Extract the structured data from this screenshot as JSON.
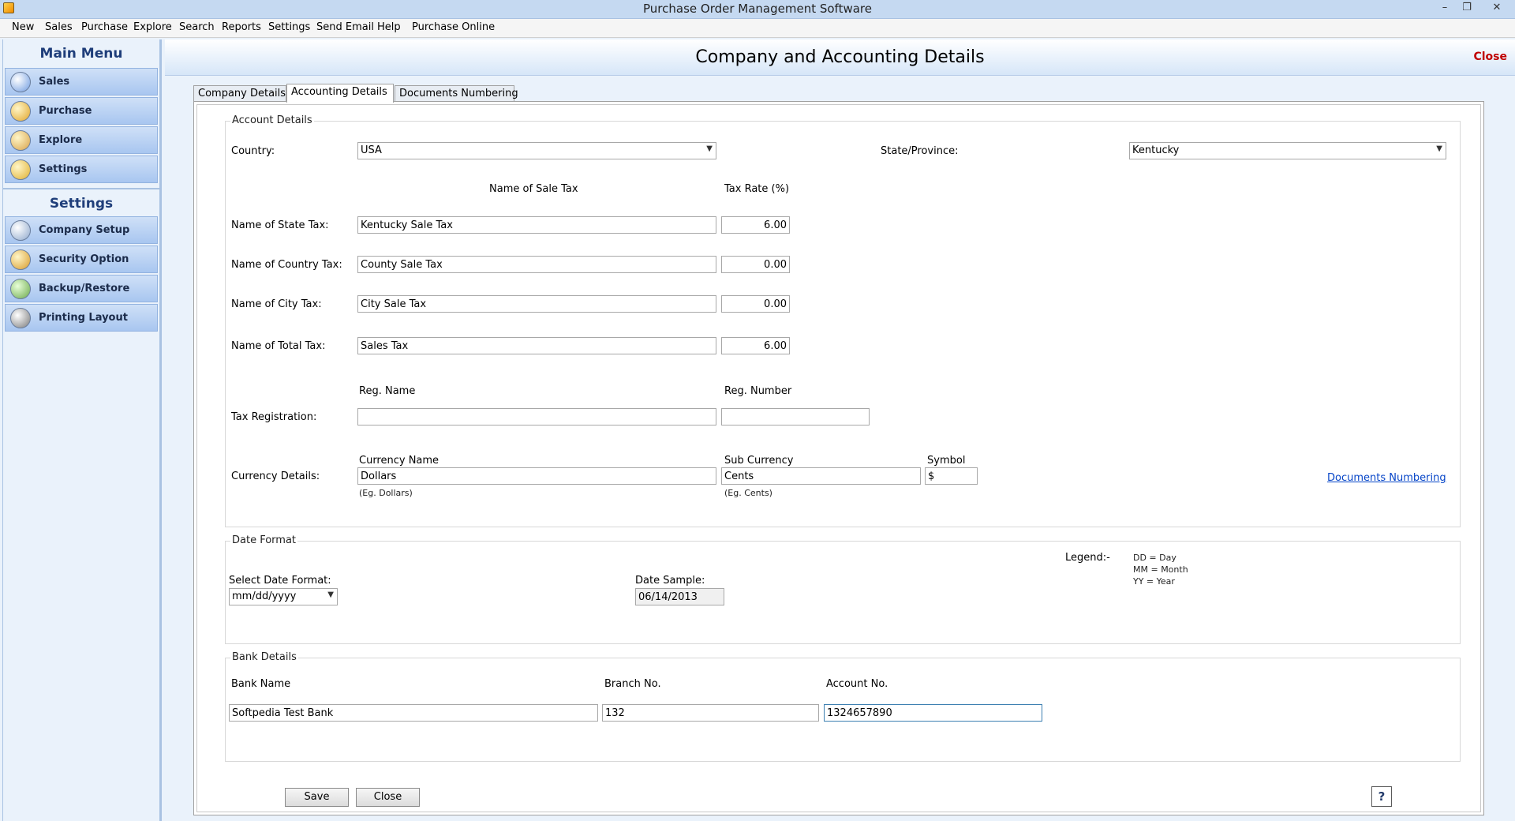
{
  "window": {
    "title": "Purchase Order Management Software",
    "minimize_glyph": "–",
    "restore_glyph": "❐",
    "close_glyph": "✕"
  },
  "menu": [
    "New",
    "Sales",
    "Purchase",
    "Explore",
    "Search",
    "Reports",
    "Settings",
    "Send Email",
    "Help",
    "Purchase Online"
  ],
  "sidebar": {
    "main_menu_title": "Main Menu",
    "main_items": [
      {
        "label": "Sales",
        "icon": "sales-chart-icon"
      },
      {
        "label": "Purchase",
        "icon": "purchase-box-icon"
      },
      {
        "label": "Explore",
        "icon": "explore-icon"
      },
      {
        "label": "Settings",
        "icon": "settings-gear-icon"
      }
    ],
    "settings_title": "Settings",
    "settings_items": [
      {
        "label": "Company Setup",
        "icon": "company-setup-icon"
      },
      {
        "label": "Security Option",
        "icon": "lock-icon"
      },
      {
        "label": "Backup/Restore",
        "icon": "backup-restore-icon"
      },
      {
        "label": "Printing Layout",
        "icon": "printer-icon"
      }
    ]
  },
  "page": {
    "title": "Company and Accounting Details",
    "close_label": "Close"
  },
  "tabs": [
    {
      "label": "Company Details",
      "active": false
    },
    {
      "label": "Accounting Details",
      "active": true
    },
    {
      "label": "Documents Numbering",
      "active": false
    }
  ],
  "account_details": {
    "group_label": "Account Details",
    "country_label": "Country:",
    "country_value": "USA",
    "state_label": "State/Province:",
    "state_value": "Kentucky",
    "col_name_header": "Name of Sale Tax",
    "col_rate_header": "Tax Rate (%)",
    "taxes": [
      {
        "label": "Name of State Tax:",
        "name": "Kentucky Sale Tax",
        "rate": "6.00"
      },
      {
        "label": "Name of Country Tax:",
        "name": "County Sale Tax",
        "rate": "0.00"
      },
      {
        "label": "Name of City Tax:",
        "name": "City Sale Tax",
        "rate": "0.00"
      },
      {
        "label": "Name of Total Tax:",
        "name": "Sales Tax",
        "rate": "6.00"
      }
    ],
    "reg_name_header": "Reg. Name",
    "reg_number_header": "Reg. Number",
    "tax_registration_label": "Tax Registration:",
    "reg_name_value": "",
    "reg_number_value": "",
    "currency_label": "Currency Details:",
    "currency_name_header": "Currency Name",
    "currency_name_value": "Dollars",
    "currency_name_hint": "(Eg. Dollars)",
    "sub_currency_header": "Sub Currency",
    "sub_currency_value": "Cents",
    "sub_currency_hint": "(Eg. Cents)",
    "symbol_header": "Symbol",
    "symbol_value": "$",
    "documents_numbering_link": "Documents Numbering"
  },
  "date_format": {
    "group_label": "Date Format",
    "select_label": "Select Date Format:",
    "select_value": "mm/dd/yyyy",
    "sample_label": "Date Sample:",
    "sample_value": "06/14/2013",
    "legend_label": "Legend:-",
    "legend_lines": [
      "DD = Day",
      "MM = Month",
      "YY = Year"
    ]
  },
  "bank_details": {
    "group_label": "Bank Details",
    "bank_name_label": "Bank Name",
    "bank_name_value": "Softpedia Test Bank",
    "branch_label": "Branch No.",
    "branch_value": "132",
    "account_label": "Account No.",
    "account_value": "1324657890"
  },
  "footer": {
    "save_label": "Save",
    "close_label": "Close",
    "help_glyph": "?"
  }
}
